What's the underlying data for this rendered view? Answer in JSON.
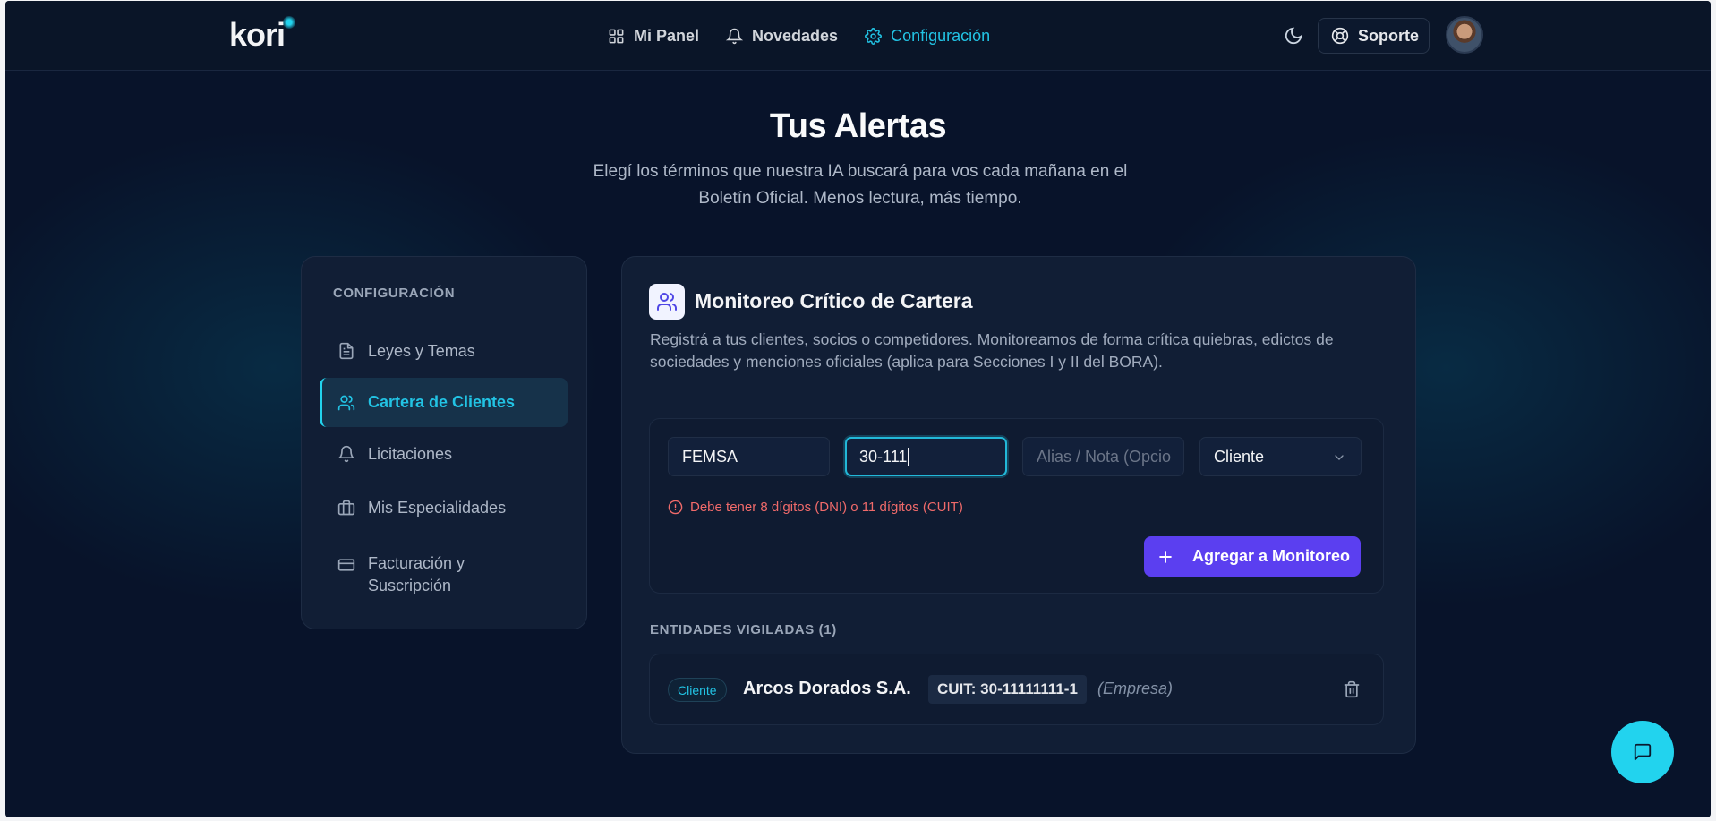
{
  "header": {
    "logo": "kori",
    "nav": [
      {
        "label": "Mi Panel",
        "icon": "grid-icon"
      },
      {
        "label": "Novedades",
        "icon": "bell-icon"
      },
      {
        "label": "Configuración",
        "icon": "gear-icon"
      }
    ],
    "support_label": "Soporte"
  },
  "hero": {
    "title": "Tus Alertas",
    "subtitle": "Elegí los términos que nuestra IA buscará para vos cada mañana en el Boletín Oficial. Menos lectura, más tiempo."
  },
  "sidebar": {
    "heading": "CONFIGURACIÓN",
    "items": [
      {
        "label": "Leyes y Temas",
        "icon": "document-icon"
      },
      {
        "label": "Cartera de Clientes",
        "icon": "users-icon",
        "active": true
      },
      {
        "label": "Licitaciones",
        "icon": "bell-icon"
      },
      {
        "label": "Mis Especialidades",
        "icon": "briefcase-icon"
      },
      {
        "label": "Facturación y Suscripción",
        "icon": "credit-card-icon"
      }
    ]
  },
  "card": {
    "title": "Monitoreo Crítico de Cartera",
    "description": "Registrá a tus clientes, socios o competidores. Monitoreamos de forma crítica quiebras, edictos de sociedades y menciones oficiales (aplica para Secciones I y II del BORA).",
    "form": {
      "name_value": "FEMSA",
      "id_value": "30-111",
      "alias_placeholder": "Alias / Nota (Opcio",
      "type_selected": "Cliente",
      "error": "Debe tener 8 dígitos (DNI) o 11 dígitos (CUIT)",
      "add_label": "Agregar a Monitoreo"
    },
    "watched_heading": "ENTIDADES VIGILADAS (1)",
    "entities": [
      {
        "badge": "Cliente",
        "name": "Arcos Dorados S.A.",
        "cuit": "CUIT: 30-11111111-1",
        "type": "(Empresa)"
      }
    ]
  },
  "colors": {
    "background": "#08132a",
    "accent": "#22d3ee",
    "primary_button": "#5b3ff0",
    "error": "#f06a6a"
  }
}
